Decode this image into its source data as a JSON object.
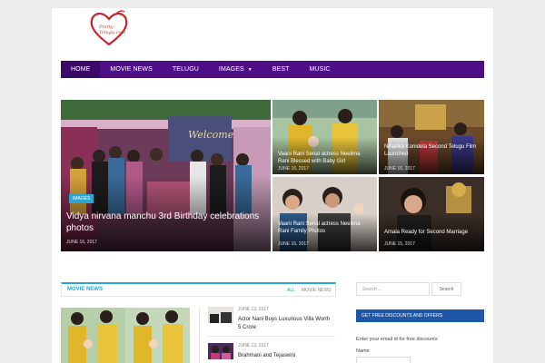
{
  "site": {
    "logo_icon": "heart-logo",
    "logo_text": "Pretty Telugu.com",
    "brand_color": "#4e0f86",
    "accent_color": "#2aa6d6"
  },
  "nav": {
    "items": [
      {
        "label": "HOME",
        "active": true
      },
      {
        "label": "MOVIE NEWS"
      },
      {
        "label": "TELUGU"
      },
      {
        "label": "IMAGES",
        "has_dropdown": true,
        "icon": "chevron-down-icon"
      },
      {
        "label": "BEST"
      },
      {
        "label": "MUSIC"
      }
    ]
  },
  "featured": {
    "main": {
      "badge": "IMAGES",
      "title": "Vidya nirvana manchu 3rd Birthday celebrations photos",
      "date": "JUNE 16, 2017"
    },
    "tiles": [
      {
        "title": "Vaani Rani Serial actress Neelima Rani Blessed with Baby Girl",
        "date": "JUNE 16, 2017"
      },
      {
        "title": "Niharika Konidela Second Telugu Film Launched",
        "date": "JUNE 16, 2017"
      },
      {
        "title": "Vaani Rani Serial actress Neelima Rani Family Photos",
        "date": "JUNE 16, 2017"
      },
      {
        "title": "Amala Ready for Second Marriage",
        "date": "JUNE 15, 2017"
      }
    ]
  },
  "movie_news": {
    "title": "MOVIE NEWS",
    "filters": [
      "ALL",
      "MOVIE NEWS"
    ],
    "side_items": [
      {
        "date": "JUNE 12, 2017",
        "title": "Actor Nani Buys Luxurious Villa Worth 5 Crore"
      },
      {
        "date": "JUNE 12, 2017",
        "title": "Brahmani and Tejaswini"
      }
    ]
  },
  "sidebar": {
    "search_placeholder": "Search ...",
    "search_button": "Search",
    "offer_title": "GET FREE DISCOUNTS AND OFFERS",
    "email_note": "Enter your email id for free discounts",
    "name_label": "Name"
  }
}
